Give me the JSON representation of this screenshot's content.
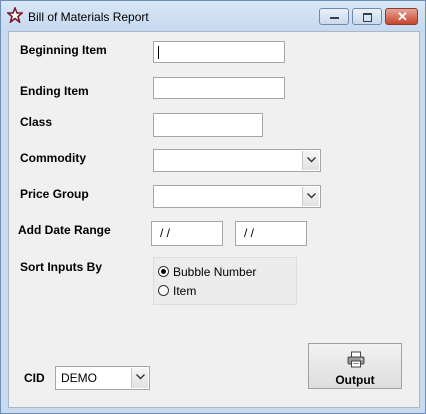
{
  "window": {
    "title": "Bill of Materials Report",
    "icon": "star-icon",
    "controls": {
      "minimize": "minimize-icon",
      "maximize": "maximize-icon",
      "close": "close-icon"
    }
  },
  "form": {
    "beginning_item": {
      "label": "Beginning Item",
      "value": ""
    },
    "ending_item": {
      "label": "Ending Item",
      "value": ""
    },
    "class": {
      "label": "Class",
      "value": ""
    },
    "commodity": {
      "label": "Commodity",
      "value": ""
    },
    "price_group": {
      "label": "Price Group",
      "value": ""
    },
    "date_range": {
      "label": "Add Date Range",
      "from": " / /",
      "to": " / /"
    },
    "sort": {
      "label": "Sort Inputs By",
      "options": [
        {
          "label": "Bubble Number",
          "checked": true
        },
        {
          "label": "Item",
          "checked": false
        }
      ]
    },
    "cid": {
      "label": "CID",
      "value": "DEMO"
    }
  },
  "actions": {
    "output_label": "Output",
    "output_icon": "printer-icon"
  },
  "colors": {
    "accent_star": "#7a1a2c",
    "close_button": "#c5452f",
    "client_bg": "#f0f0f0"
  }
}
